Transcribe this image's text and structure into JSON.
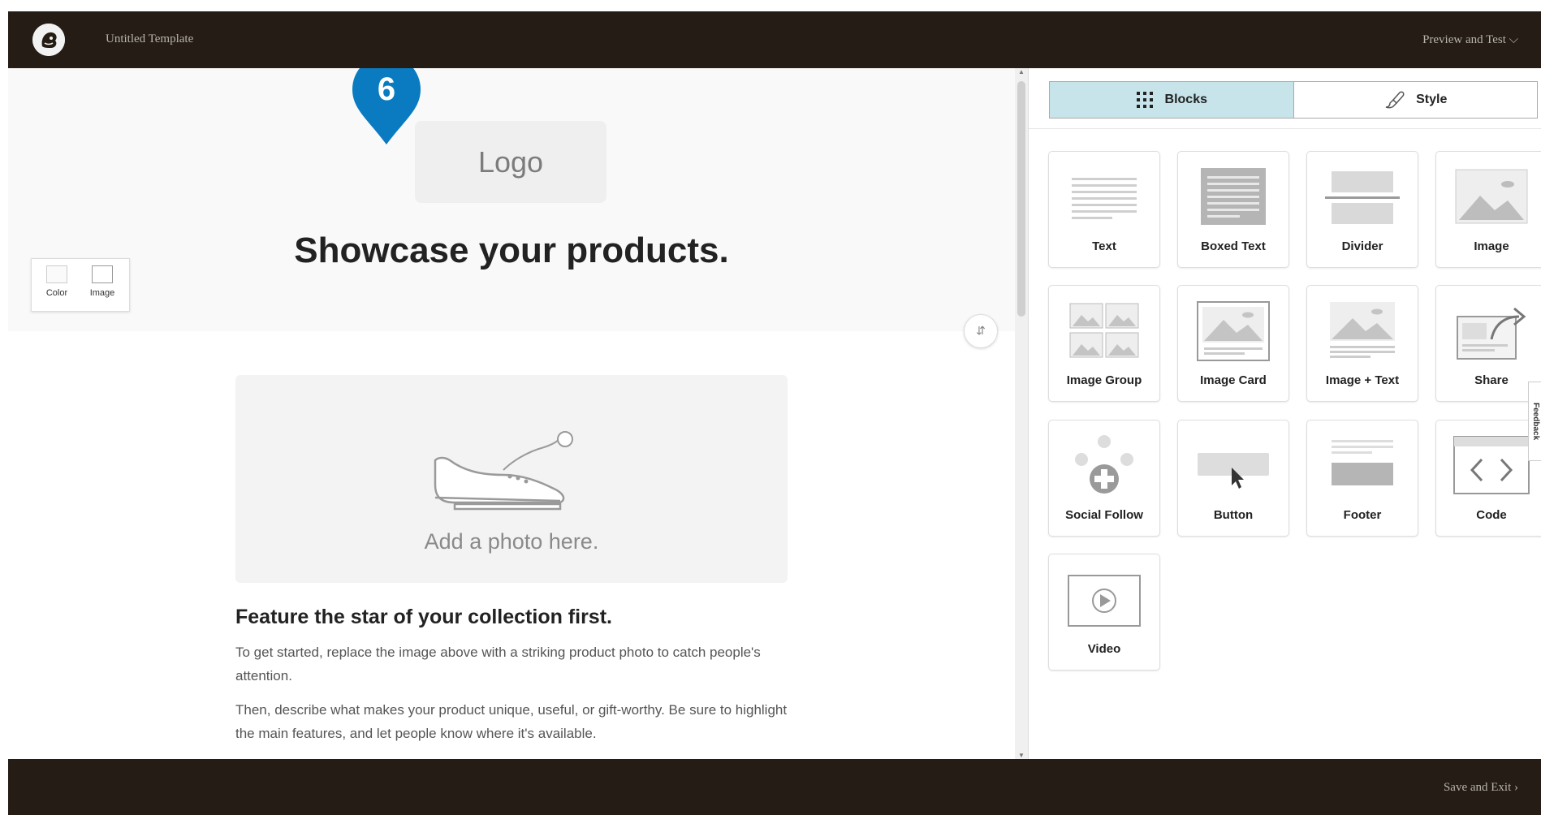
{
  "header": {
    "template_title": "Untitled Template",
    "preview_label": "Preview and Test ⌵"
  },
  "footer_bar": {
    "save_label": "Save and Exit ›"
  },
  "canvas": {
    "step_badge": "6",
    "logo_placeholder": "Logo",
    "headline": "Showcase your products.",
    "background_tools": [
      "Color",
      "Image"
    ],
    "photo_caption": "Add a photo here.",
    "feature_heading": "Feature the star of your collection first.",
    "paragraph_1": "To get started, replace the image above with a striking product photo to catch people's attention.",
    "paragraph_2": "Then, describe what makes your product unique, useful, or gift-worthy. Be sure to highlight the main features, and let people know where it's available."
  },
  "panel": {
    "tabs": [
      {
        "label": "Blocks",
        "icon": "grid-icon",
        "active": true
      },
      {
        "label": "Style",
        "icon": "paintbrush-icon",
        "active": false
      }
    ],
    "blocks": [
      {
        "label": "Text",
        "icon": "text-block-icon"
      },
      {
        "label": "Boxed Text",
        "icon": "boxed-text-block-icon"
      },
      {
        "label": "Divider",
        "icon": "divider-block-icon"
      },
      {
        "label": "Image",
        "icon": "image-block-icon"
      },
      {
        "label": "Image Group",
        "icon": "image-group-block-icon"
      },
      {
        "label": "Image Card",
        "icon": "image-card-block-icon"
      },
      {
        "label": "Image + Text",
        "icon": "image-text-block-icon"
      },
      {
        "label": "Share",
        "icon": "share-block-icon"
      },
      {
        "label": "Social Follow",
        "icon": "social-follow-block-icon"
      },
      {
        "label": "Button",
        "icon": "button-block-icon"
      },
      {
        "label": "Footer",
        "icon": "footer-block-icon"
      },
      {
        "label": "Code",
        "icon": "code-block-icon"
      },
      {
        "label": "Video",
        "icon": "video-block-icon"
      }
    ],
    "feedback_label": "Feedback"
  },
  "colors": {
    "topbar": "#241c15",
    "active_tab": "#c6e4ea",
    "badge": "#0a7bc1"
  }
}
